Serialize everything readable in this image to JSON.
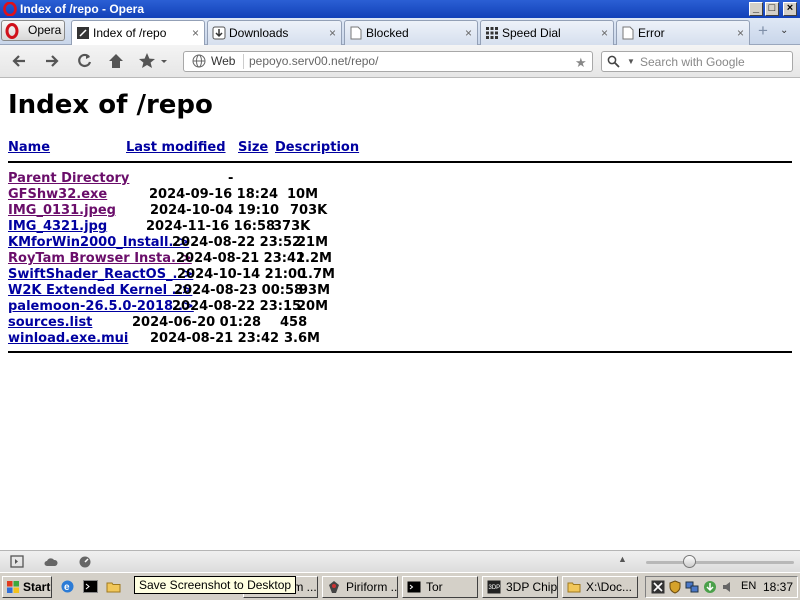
{
  "window": {
    "title": "Index of /repo - Opera",
    "buttons": [
      "minimize-button",
      "maximize-button",
      "close-button"
    ]
  },
  "menu": {
    "label": "Opera"
  },
  "tabs": [
    {
      "label": "Index of /repo",
      "icon": "page-icon-dark"
    },
    {
      "label": "Downloads",
      "icon": "downloads-icon"
    },
    {
      "label": "Blocked",
      "icon": "page-icon"
    },
    {
      "label": "Speed Dial",
      "icon": "speed-dial-icon"
    },
    {
      "label": "Error",
      "icon": "page-icon"
    }
  ],
  "tab_close": "×",
  "newtab_symbol": "+",
  "tabmenu_symbol": "⌄",
  "toolbar": {
    "web_label": "Web",
    "url": "pepoyo.serv00.net/repo/",
    "search_placeholder": "Search with Google"
  },
  "page": {
    "heading": "Index of /repo",
    "columns": {
      "name": "Name",
      "modified": "Last modified",
      "size": "Size",
      "description": "Description"
    },
    "parent": {
      "name": "Parent Directory",
      "size": "-"
    },
    "files": [
      {
        "name": "GFShw32.exe",
        "date": "2024-09-16 18:24",
        "size": "10M",
        "visited": true
      },
      {
        "name": "IMG_0131.jpeg",
        "date": "2024-10-04 19:10",
        "size": "703K",
        "visited": true
      },
      {
        "name": "IMG_4321.jpg",
        "date": "2024-11-16 16:58",
        "size": "373K",
        "visited": false
      },
      {
        "name": "KMforWin2000_Install..>",
        "date": "2024-08-22 23:52",
        "size": "21M",
        "visited": false
      },
      {
        "name": "RoyTam Browser Insta..>",
        "date": "2024-08-21 23:41",
        "size": "2.2M",
        "visited": true
      },
      {
        "name": "SwiftShader_ReactOS_..>",
        "date": "2024-10-14 21:00",
        "size": "1.7M",
        "visited": false
      },
      {
        "name": "W2K Extended Kernel ..>",
        "date": "2024-08-23 00:58",
        "size": "93M",
        "visited": false
      },
      {
        "name": "palemoon-26.5.0-2018..>",
        "date": "2024-08-22 23:15",
        "size": "20M",
        "visited": false
      },
      {
        "name": "sources.list",
        "date": "2024-06-20 01:28",
        "size": "458",
        "visited": false
      },
      {
        "name": "winload.exe.mui",
        "date": "2024-08-21 23:42",
        "size": "3.6M",
        "visited": false
      }
    ]
  },
  "statusbar": {
    "zoom_level": 0.29
  },
  "taskbar": {
    "start_label": "Start",
    "tasks": [
      {
        "label": "iriform ...",
        "icon": "piriform-icon"
      },
      {
        "label": "Piriform ...",
        "icon": "piriform-icon"
      },
      {
        "label": "Tor",
        "icon": "console-icon"
      },
      {
        "label": "3DP Chip",
        "icon": "3dp-chip-icon"
      },
      {
        "label": "X:\\Doc...",
        "icon": "folder-icon"
      }
    ],
    "language": "EN",
    "clock": "18:37",
    "tooltip": "Save Screenshot to Desktop"
  },
  "colors": {
    "link": "#0000a0",
    "visited_link": "#6a0d6a",
    "titlebar": "#1e4fc8",
    "taskbar": "#d4d0c8"
  }
}
